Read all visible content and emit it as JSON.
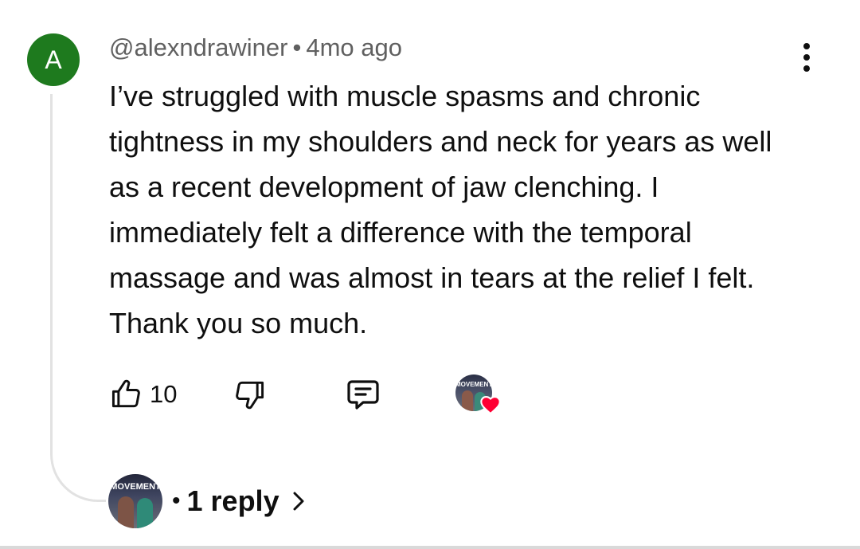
{
  "comment": {
    "avatar_letter": "A",
    "avatar_color": "#1e7a1e",
    "username": "@alexndrawiner",
    "separator": "•",
    "timestamp": "4mo ago",
    "text": "I’ve struggled with muscle spasms and chronic tightness in my shoulders and neck for years as well as a recent development of jaw clenching. I immediately felt a difference with the temporal massage and was almost in tears at the relief I felt. Thank you so much.",
    "menu_icon": "more-vert-icon"
  },
  "actions": {
    "like_icon": "thumb-up-icon",
    "like_count": "10",
    "dislike_icon": "thumb-down-icon",
    "reply_icon": "comment-icon",
    "creator_heart_icon": "heart-icon",
    "creator_avatar_text": "MOVEMENT",
    "heart_color": "#ff0033"
  },
  "replies": {
    "avatar_text": "MOVEMENT",
    "separator": "•",
    "label": "1 reply",
    "chevron_icon": "chevron-right-icon"
  }
}
